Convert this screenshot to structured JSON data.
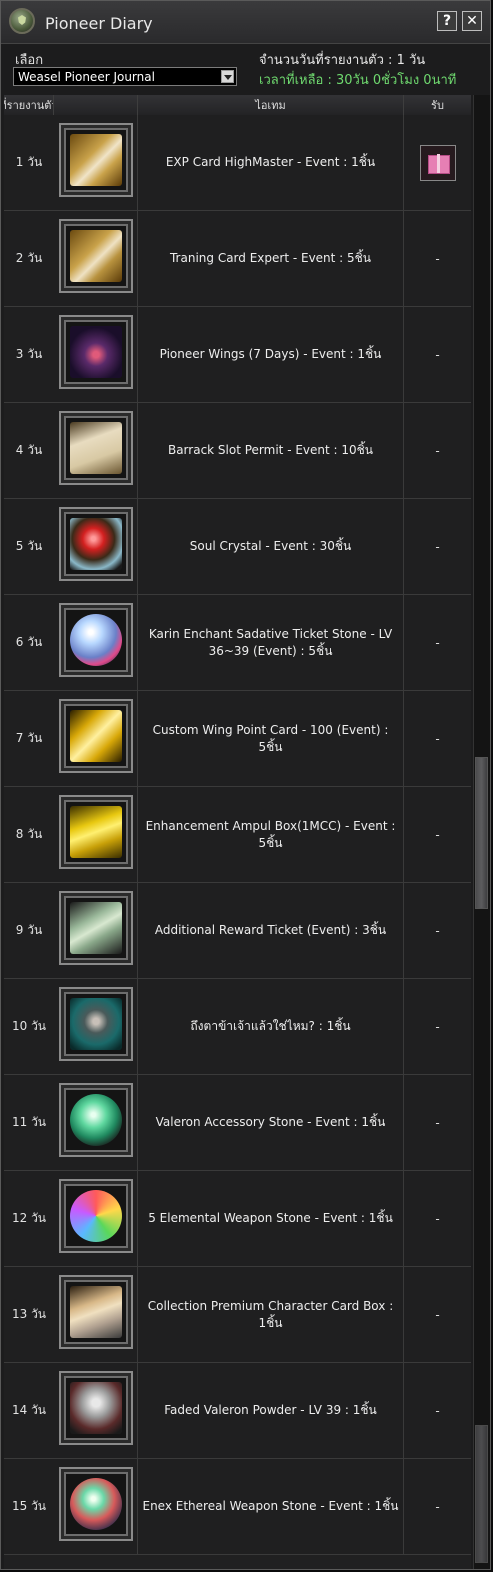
{
  "window": {
    "title": "Pioneer Diary",
    "help_label": "?",
    "close_label": "✕"
  },
  "controls": {
    "select_label": "เลือก",
    "dropdown_value": "Weasel Pioneer Journal",
    "days_reported": "จำนวนวันที่รายงานตัว : 1 วัน",
    "time_left": "เวลาที่เหลือ : 30วัน 0ชั่วโมง 0นาที"
  },
  "table": {
    "headers": [
      "ที่รายงานตัว",
      "ไอเทม",
      "รับ"
    ],
    "rows": [
      {
        "day": "1 วัน",
        "item": "EXP Card HighMaster - Event : 1ชิ้น",
        "receive": "",
        "icon": "exp-card-icon"
      },
      {
        "day": "2 วัน",
        "item": "Traning Card Expert - Event : 5ชิ้น",
        "receive": "-",
        "icon": "training-card-icon"
      },
      {
        "day": "3 วัน",
        "item": "Pioneer Wings (7 Days) - Event : 1ชิ้น",
        "receive": "-",
        "icon": "wings-icon"
      },
      {
        "day": "4 วัน",
        "item": "Barrack Slot Permit - Event : 10ชิ้น",
        "receive": "-",
        "icon": "permit-scroll-icon"
      },
      {
        "day": "5 วัน",
        "item": "Soul Crystal - Event : 30ชิ้น",
        "receive": "-",
        "icon": "soul-crystal-icon"
      },
      {
        "day": "6 วัน",
        "item": "Karin Enchant Sadative Ticket Stone - LV 36~39 (Event) : 5ชิ้น",
        "receive": "-",
        "icon": "enchant-stone-icon"
      },
      {
        "day": "7 วัน",
        "item": "Custom Wing Point Card - 100 (Event) : 5ชิ้น",
        "receive": "-",
        "icon": "gold-card-icon"
      },
      {
        "day": "8 วัน",
        "item": "Enhancement Ampul Box(1MCC) - Event : 5ชิ้น",
        "receive": "-",
        "icon": "gold-box-icon"
      },
      {
        "day": "9 วัน",
        "item": "Additional Reward Ticket (Event) : 3ชิ้น",
        "receive": "-",
        "icon": "ticket-icon"
      },
      {
        "day": "10 วัน",
        "item": "ถึงตาข้าเจ้าแล้วใช่ไหม? : 1ชิ้น",
        "receive": "-",
        "icon": "character-icon"
      },
      {
        "day": "11 วัน",
        "item": "Valeron Accessory Stone - Event : 1ชิ้น",
        "receive": "-",
        "icon": "accessory-stone-icon"
      },
      {
        "day": "12 วัน",
        "item": "5 Elemental Weapon Stone - Event : 1ชิ้น",
        "receive": "-",
        "icon": "elemental-stone-icon"
      },
      {
        "day": "13 วัน",
        "item": "Collection Premium Character Card Box : 1ชิ้น",
        "receive": "-",
        "icon": "card-box-icon"
      },
      {
        "day": "14 วัน",
        "item": "Faded Valeron Powder - LV 39 : 1ชิ้น",
        "receive": "-",
        "icon": "powder-bag-icon"
      },
      {
        "day": "15 วัน",
        "item": "Enex Ethereal Weapon Stone - Event : 1ชิ้น",
        "receive": "-",
        "icon": "weapon-stone-icon"
      }
    ]
  },
  "colors": {
    "time_left": "#6fd96f",
    "gift": "#e67fb4"
  }
}
